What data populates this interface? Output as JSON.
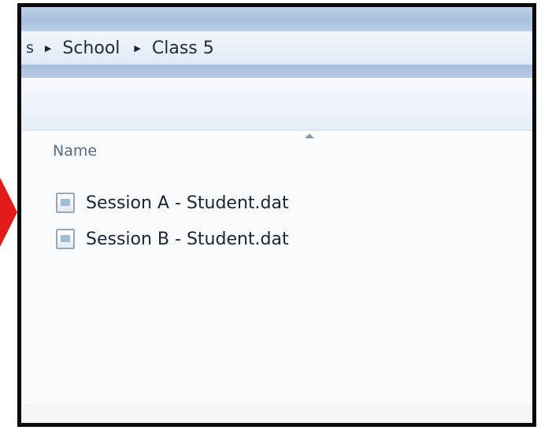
{
  "addressbar": {
    "partial_crumb": "s",
    "crumbs": [
      "School",
      "Class 5"
    ]
  },
  "list": {
    "column_header": "Name",
    "files": [
      {
        "name": "Session A - Student.dat",
        "icon": "document-icon"
      },
      {
        "name": "Session B - Student.dat",
        "icon": "document-icon"
      }
    ]
  },
  "colors": {
    "highlight_arrow": "#e21a1a",
    "frame_border": "#0b0b0b",
    "titlebar": "#a9c1df"
  }
}
